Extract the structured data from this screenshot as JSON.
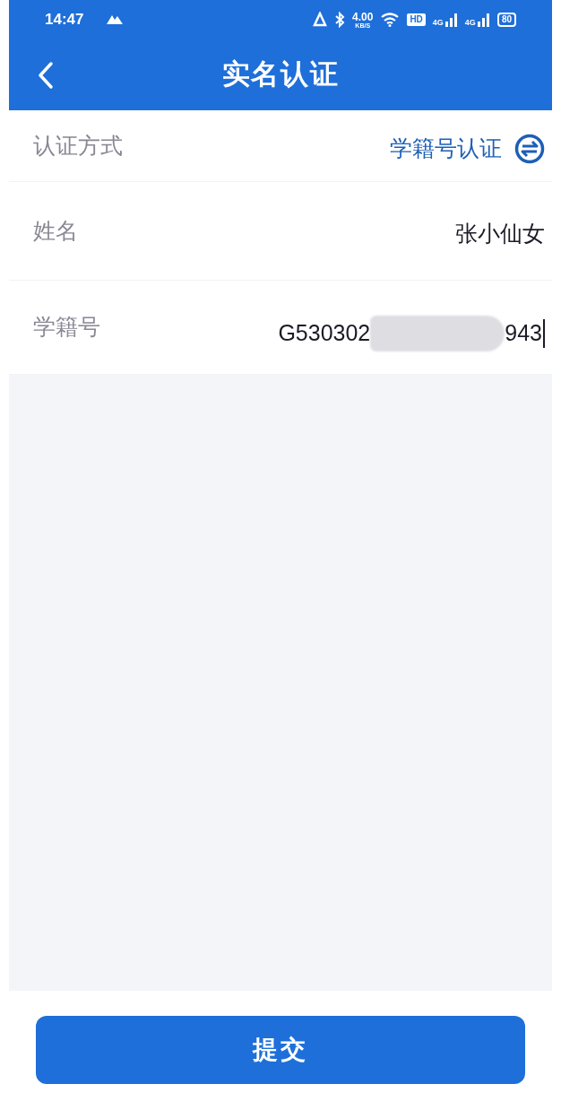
{
  "status_bar": {
    "time": "14:47",
    "speed": "4.00",
    "speed_unit": "KB/S",
    "hd": "HD",
    "networks": [
      "4G",
      "4G"
    ],
    "battery": "80"
  },
  "header": {
    "title": "实名认证"
  },
  "form": [
    {
      "kind": "select",
      "label": "认证方式",
      "value": "学籍号认证"
    },
    {
      "kind": "text",
      "label": "姓名",
      "value": "张小仙女"
    },
    {
      "kind": "input",
      "label": "学籍号",
      "value_start": "G530302",
      "value_end": "943",
      "redacted": true,
      "focused": true
    }
  ],
  "submit": "提交"
}
